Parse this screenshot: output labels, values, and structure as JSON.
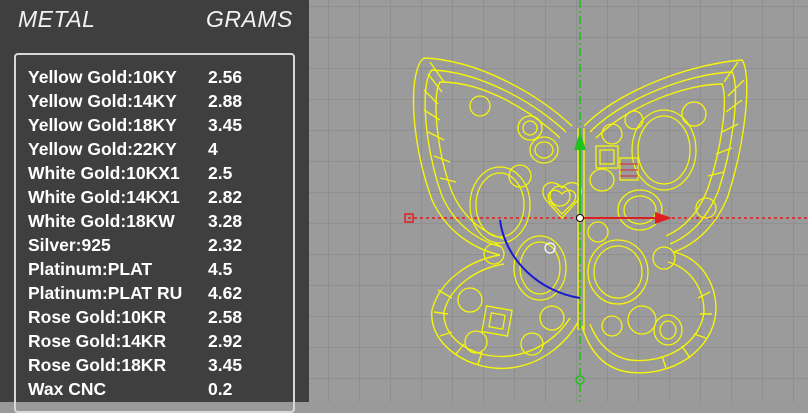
{
  "panel": {
    "header_metal": "METAL",
    "header_grams": "GRAMS",
    "rows": [
      {
        "metal": "Yellow Gold:10KY",
        "grams": "2.56"
      },
      {
        "metal": "Yellow Gold:14KY",
        "grams": "2.88"
      },
      {
        "metal": "Yellow Gold:18KY",
        "grams": "3.45"
      },
      {
        "metal": "Yellow Gold:22KY",
        "grams": "4"
      },
      {
        "metal": "White Gold:10KX1",
        "grams": "2.5"
      },
      {
        "metal": "White Gold:14KX1",
        "grams": "2.82"
      },
      {
        "metal": "White Gold:18KW",
        "grams": "3.28"
      },
      {
        "metal": "Silver:925",
        "grams": "2.32"
      },
      {
        "metal": "Platinum:PLAT",
        "grams": "4.5"
      },
      {
        "metal": "Platinum:PLAT RU",
        "grams": "4.62"
      },
      {
        "metal": "Rose Gold:10KR",
        "grams": "2.58"
      },
      {
        "metal": "Rose Gold:14KR",
        "grams": "2.92"
      },
      {
        "metal": "Rose Gold:18KR",
        "grams": "3.45"
      },
      {
        "metal": "Wax  CNC",
        "grams": "0.2"
      }
    ]
  },
  "viewport": {
    "background": "#9b9b9b",
    "wireframe_color": "#f5f50a",
    "axis_x_color": "#e02020",
    "axis_y_color": "#20c020",
    "arc_color": "#1a1ad0"
  }
}
